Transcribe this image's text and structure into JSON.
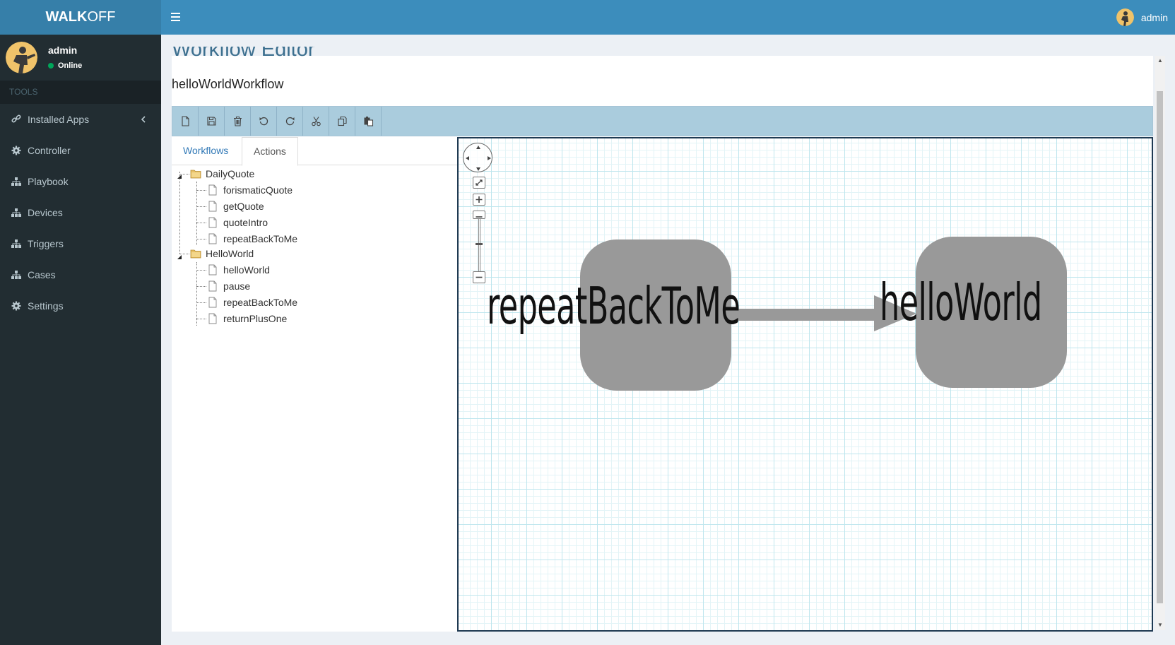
{
  "app": {
    "logo_bold": "WALK",
    "logo_light": "OFF",
    "top_user": "admin"
  },
  "sidebar": {
    "user_name": "admin",
    "user_status": "Online",
    "header": "TOOLS",
    "items": [
      {
        "label": "Installed Apps",
        "icon": "link-icon"
      },
      {
        "label": "Controller",
        "icon": "gear-icon"
      },
      {
        "label": "Playbook",
        "icon": "sitemap-icon"
      },
      {
        "label": "Devices",
        "icon": "sitemap-icon"
      },
      {
        "label": "Triggers",
        "icon": "sitemap-icon"
      },
      {
        "label": "Cases",
        "icon": "sitemap-icon"
      },
      {
        "label": "Settings",
        "icon": "gear-icon"
      }
    ]
  },
  "page": {
    "title": "Workflow Editor",
    "workflow_name": "helloWorldWorkflow"
  },
  "toolbar": {
    "buttons": [
      "new-file-icon",
      "save-icon",
      "trash-icon",
      "undo-icon",
      "redo-icon",
      "cut-icon",
      "copy-icon",
      "paste-icon"
    ]
  },
  "tabs": {
    "workflows": "Workflows",
    "actions": "Actions",
    "active": "Actions"
  },
  "tree": [
    {
      "app": "DailyQuote",
      "actions": [
        "forismaticQuote",
        "getQuote",
        "quoteIntro",
        "repeatBackToMe"
      ]
    },
    {
      "app": "HelloWorld",
      "actions": [
        "helloWorld",
        "pause",
        "repeatBackToMe",
        "returnPlusOne"
      ]
    }
  ],
  "graph": {
    "nodes": [
      {
        "label": "repeatBackToMe"
      },
      {
        "label": "helloWorld"
      }
    ],
    "edge": {
      "from": "repeatBackToMe",
      "to": "helloWorld"
    },
    "node_color": "#999999",
    "edge_color": "#999999"
  },
  "colors": {
    "topbar": "#3c8dbc",
    "sidebar": "#222d32",
    "toolbar": "#aaccdd"
  }
}
